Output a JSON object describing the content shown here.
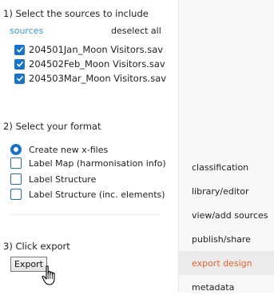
{
  "step1": {
    "title": "1) Select the sources to include",
    "sources_link": "sources",
    "deselect_all": "deselect all",
    "files": [
      {
        "name": "204501Jan_Moon Visitors.sav",
        "checked": true
      },
      {
        "name": "204502Feb_Moon Visitors.sav",
        "checked": true
      },
      {
        "name": "204503Mar_Moon Visitors.sav",
        "checked": true
      }
    ]
  },
  "step2": {
    "title": "2) Select your format",
    "options": [
      {
        "label": "Create new x-files",
        "type": "radio",
        "selected": true
      },
      {
        "label": "Label Map (harmonisation info)",
        "type": "checkbox",
        "checked": false
      },
      {
        "label": "Label Structure",
        "type": "checkbox",
        "checked": false
      },
      {
        "label": "Label Structure (inc. elements)",
        "type": "checkbox",
        "checked": false
      }
    ]
  },
  "step3": {
    "title": "3) Click export",
    "export_button": "Export"
  },
  "nav": {
    "items": [
      {
        "label": "classification",
        "active": false,
        "color": "#222222"
      },
      {
        "label": "library/editor",
        "active": false,
        "color": "#222222"
      },
      {
        "label": "view/add sources",
        "active": false,
        "color": "#222222"
      },
      {
        "label": "publish/share",
        "active": false,
        "color": "#222222"
      },
      {
        "label": "export design",
        "active": true,
        "color": "#e8622c"
      },
      {
        "label": "metadata",
        "active": false,
        "color": "#222222"
      }
    ]
  },
  "colors": {
    "accent_blue": "#1a73c7",
    "link_blue": "#3b9bd6",
    "active_orange": "#e8622c"
  }
}
